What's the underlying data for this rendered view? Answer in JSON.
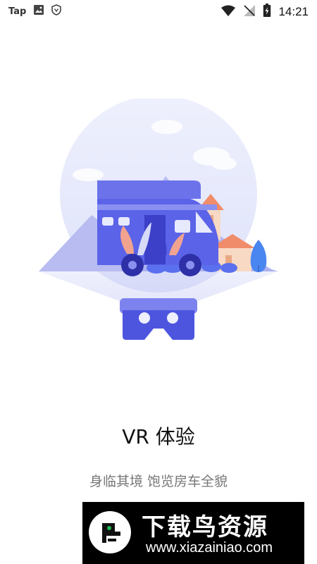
{
  "status_bar": {
    "app_label": "Tap",
    "time": "14:21",
    "icons": [
      "image-icon",
      "shield-icon",
      "wifi-icon",
      "no-signal-icon",
      "battery-icon"
    ]
  },
  "colors": {
    "primary": "#5b63e8",
    "primary_dark": "#3c3fc8",
    "circle_bg": "#e6e9fb",
    "mountain": "#b4b8f0",
    "roof": "#f08c6a",
    "house_wall": "#f7d9c4",
    "tree": "#4a86f0"
  },
  "onboarding": {
    "title": "VR 体验",
    "subtitle": "身临其境 饱览房车全貌"
  },
  "watermark": {
    "brand": "下载鸟资源",
    "url": "www.xiazainiao.com"
  }
}
